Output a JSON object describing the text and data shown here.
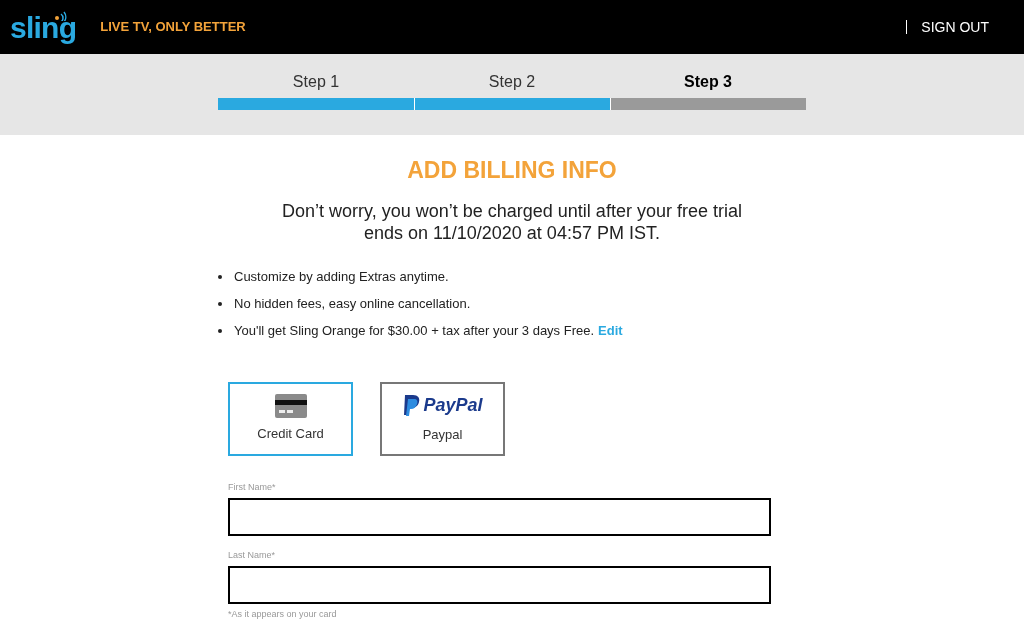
{
  "header": {
    "logo": "sling",
    "tagline": "LIVE TV, ONLY BETTER",
    "sign_out": "SIGN OUT"
  },
  "steps": [
    {
      "label": "Step 1",
      "selected": false,
      "done": true
    },
    {
      "label": "Step 2",
      "selected": false,
      "done": true
    },
    {
      "label": "Step 3",
      "selected": true,
      "done": false
    }
  ],
  "title": "ADD BILLING INFO",
  "subtitle": [
    "Don’t worry, you won’t be charged until after your free trial",
    "ends on 11/10/2020 at 04:57 PM IST."
  ],
  "bullets": [
    {
      "text": "Customize by adding Extras anytime."
    },
    {
      "text": "No hidden fees, easy online cancellation."
    },
    {
      "text": "You'll get Sling Orange for $30.00 + tax after your 3 days Free.",
      "link": "Edit"
    }
  ],
  "payment_methods": [
    {
      "kind": "card",
      "label": "Credit Card",
      "selected": true
    },
    {
      "kind": "paypal",
      "logo_text": "PayPal",
      "label": "Paypal",
      "selected": false
    }
  ],
  "fields": [
    {
      "label": "First Name*"
    },
    {
      "label": "Last Name*",
      "hint": "*As it appears on your card"
    }
  ]
}
